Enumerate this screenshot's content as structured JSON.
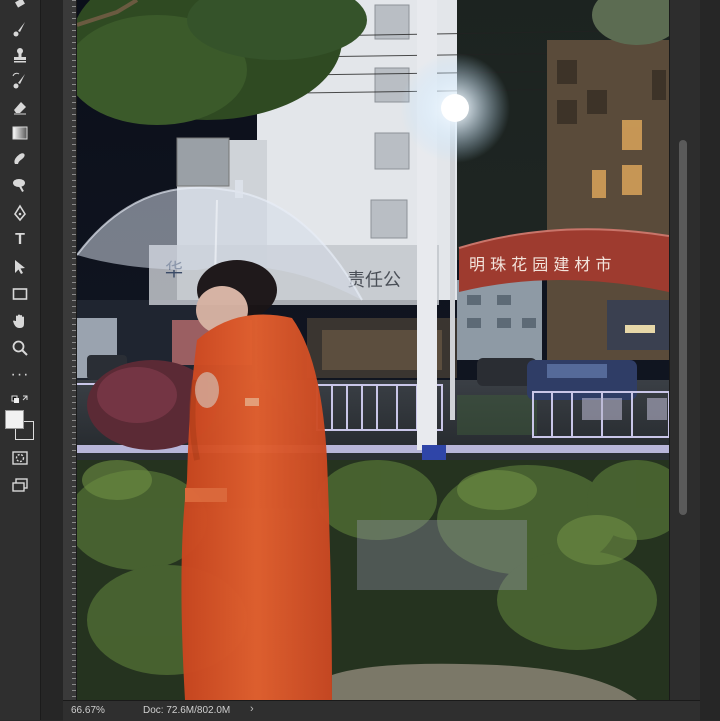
{
  "statusbar": {
    "zoom": "66.67%",
    "doc_info": "Doc: 72.6M/802.0M",
    "arrow": "›"
  },
  "photo": {
    "sign_arch": "明 珠 花 园 建 材 市",
    "sign_building_left": "华",
    "sign_building_right": "责任公"
  },
  "tools": [
    "brush-icon",
    "stamp-icon",
    "history-brush-icon",
    "eraser-icon",
    "gradient-icon",
    "smudge-icon",
    "dodge-icon",
    "pen-icon",
    "type-icon",
    "path-select-icon",
    "rectangle-icon",
    "hand-icon",
    "zoom-icon",
    "more-tools-icon",
    "swap-colors-icon",
    "color-swatches",
    "quick-mask-icon",
    "screen-mode-icon"
  ],
  "colors": {
    "coat": "#d9502a",
    "sign": "#9e3b2f",
    "railing_light": "#c9c6e8"
  }
}
